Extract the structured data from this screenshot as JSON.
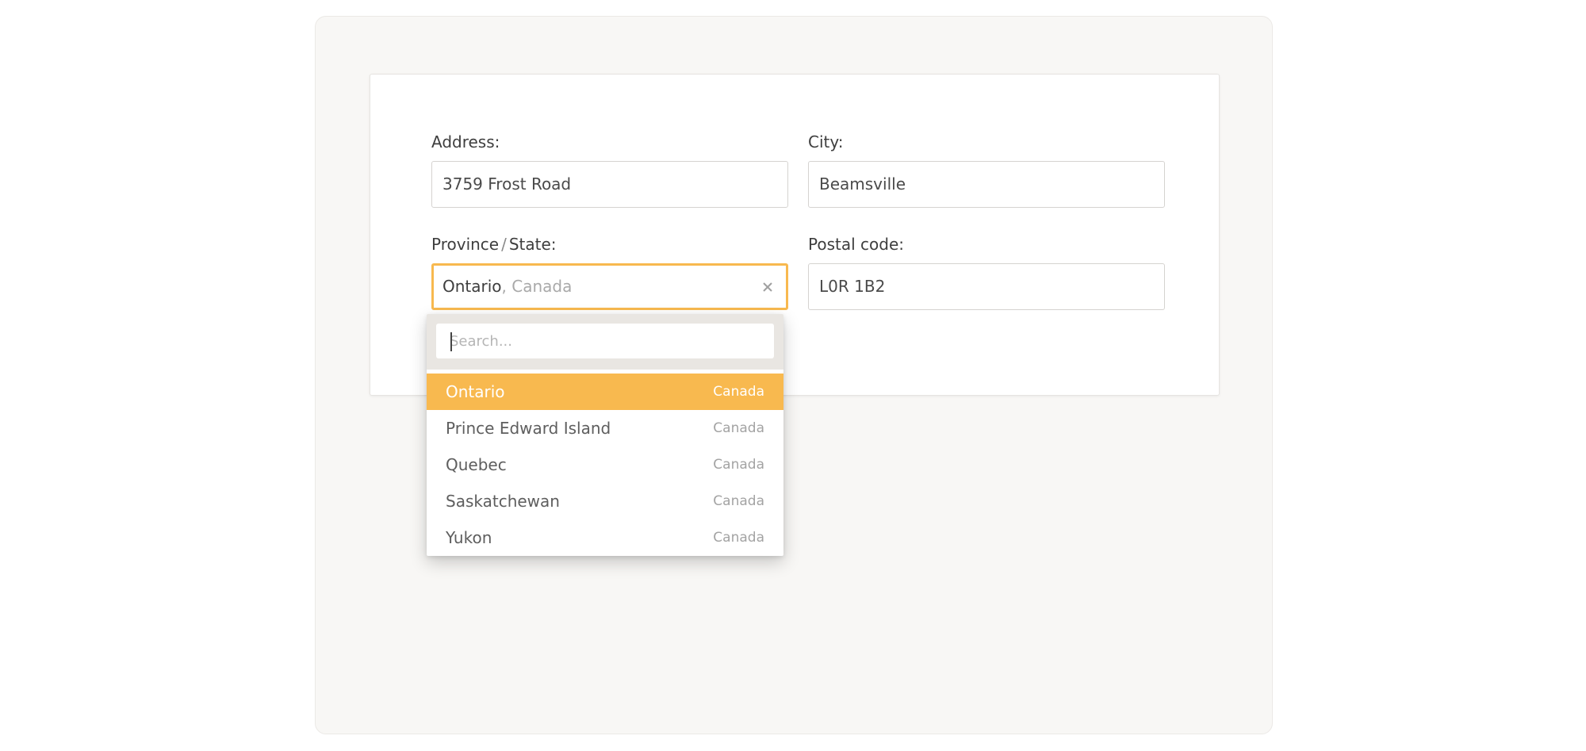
{
  "form": {
    "address": {
      "label": "Address:",
      "value": "3759 Frost Road"
    },
    "city": {
      "label": "City:",
      "value": "Beamsville"
    },
    "province": {
      "label_left": "Province",
      "label_sep": "/",
      "label_right": "State:",
      "selected_name": "Ontario",
      "selected_sep": ", ",
      "selected_country": "Canada",
      "clear_icon": "close-icon"
    },
    "postal": {
      "label": "Postal code:",
      "value": "L0R 1B2"
    }
  },
  "dropdown": {
    "search_placeholder": "Search...",
    "items": [
      {
        "name": "Ontario",
        "country": "Canada",
        "active": true
      },
      {
        "name": "Prince Edward Island",
        "country": "Canada",
        "active": false
      },
      {
        "name": "Quebec",
        "country": "Canada",
        "active": false
      },
      {
        "name": "Saskatchewan",
        "country": "Canada",
        "active": false
      },
      {
        "name": "Yukon",
        "country": "Canada",
        "active": false
      }
    ]
  },
  "colors": {
    "accent": "#f8b94f",
    "panel_bg": "#f8f7f5",
    "search_band": "#e9e6e2"
  }
}
